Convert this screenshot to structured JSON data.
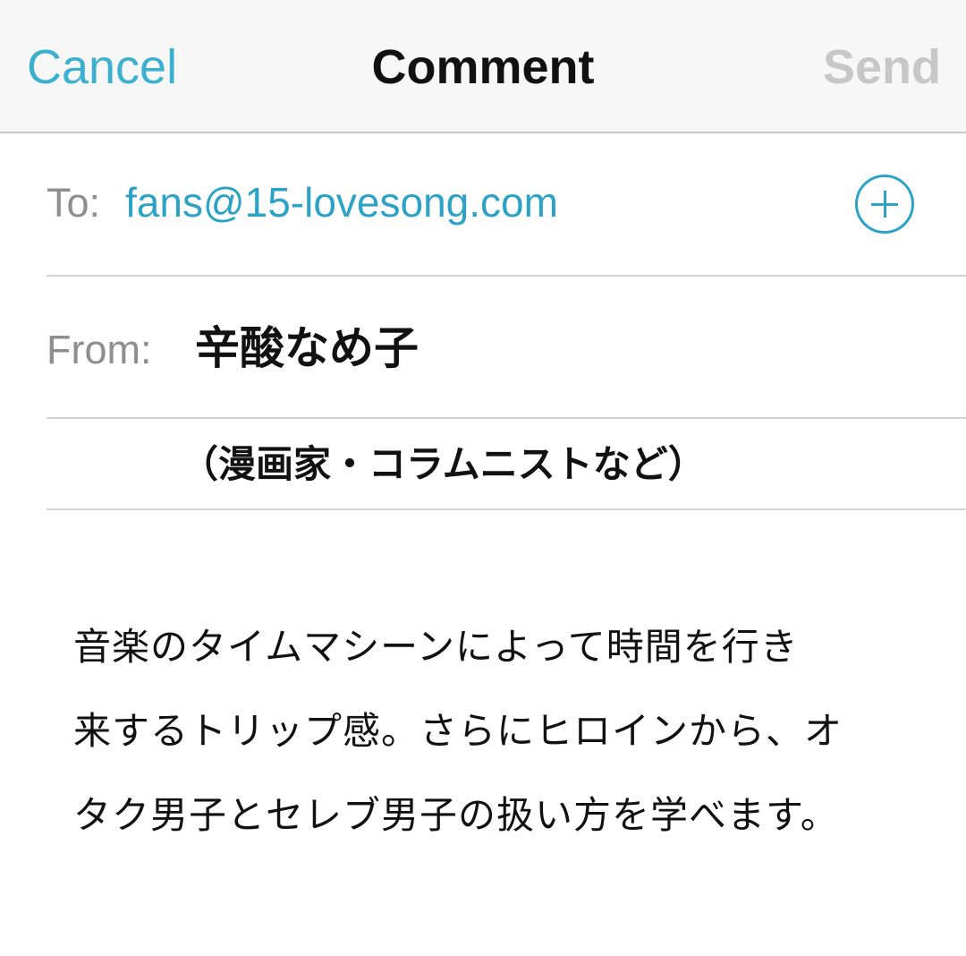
{
  "nav": {
    "cancel_label": "Cancel",
    "title": "Comment",
    "send_label": "Send"
  },
  "to": {
    "label": "To:",
    "value": "fans@15-lovesong.com",
    "add_icon": "plus-circle-icon"
  },
  "from": {
    "label": "From:",
    "value": "辛酸なめ子",
    "subtitle": "（漫画家・コラムニストなど）"
  },
  "body": {
    "lines": [
      "音楽のタイムマシーンによって時間を行き",
      "来するトリップ感。さらにヒロインから、オ",
      "タク男子とセレブ男子の扱い方を学べます。"
    ]
  },
  "colors": {
    "accent": "#2ca3c6",
    "send_disabled": "#c7c7c7",
    "nav_background": "#f7f7f7"
  }
}
